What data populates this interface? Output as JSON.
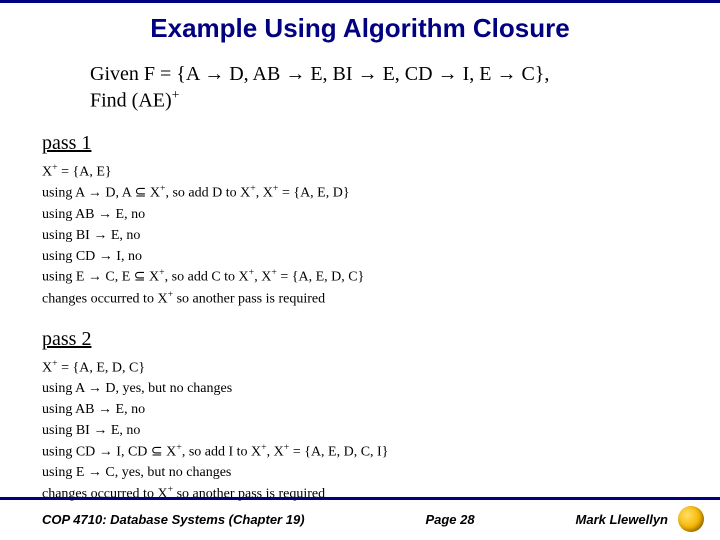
{
  "title": "Example Using Algorithm Closure",
  "given_line1": "Given F = {A → D, AB → E, BI → E, CD → I, E → C},",
  "given_line2": "Find (AE)⁺",
  "pass1": {
    "heading": "pass 1",
    "lines": [
      "X⁺ = {A, E}",
      "using A → D, A ⊆ X⁺, so add D to X⁺, X⁺ = {A, E, D}",
      "using AB → E, no",
      "using BI → E, no",
      "using CD → I, no",
      "using E → C, E ⊆ X⁺, so add C to X⁺, X⁺ = {A, E, D, C}",
      "changes occurred to X⁺ so another pass is required"
    ]
  },
  "pass2": {
    "heading": "pass 2",
    "lines": [
      "X⁺ = {A, E, D, C}",
      "using A → D, yes, but no changes",
      "using AB → E, no",
      "using BI → E, no",
      "using CD → I, CD ⊆ X⁺, so add I to X⁺, X⁺ = {A, E, D, C, I}",
      "using E → C, yes, but no changes",
      "changes occurred to X⁺ so another pass is required"
    ]
  },
  "footer": {
    "course": "COP 4710: Database Systems  (Chapter 19)",
    "page": "Page 28",
    "author": "Mark Llewellyn"
  }
}
